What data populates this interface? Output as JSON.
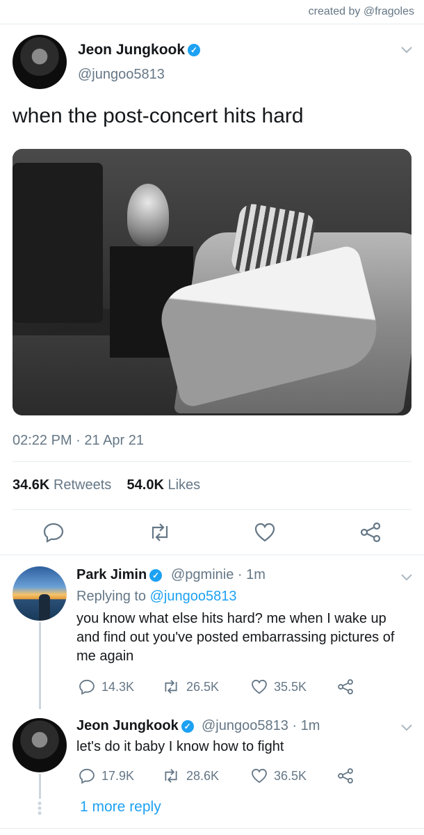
{
  "credit": "created by @fragoles",
  "main_tweet": {
    "name": "Jeon Jungkook",
    "handle": "@jungoo5813",
    "text": "when the post-concert hits hard",
    "timestamp": "02:22 PM · 21 Apr 21",
    "retweets_count": "34.6K",
    "retweets_label": "Retweets",
    "likes_count": "54.0K",
    "likes_label": "Likes"
  },
  "replies": [
    {
      "name": "Park Jimin",
      "handle": "@pgminie",
      "time": "· 1m",
      "replying_prefix": "Replying to",
      "replying_to": "@jungoo5813",
      "text": "you know what else hits hard? me when I wake up and find out you've posted embarrassing pictures of me again",
      "replies": "14.3K",
      "retweets": "26.5K",
      "likes": "35.5K"
    },
    {
      "name": "Jeon Jungkook",
      "handle": "@jungoo5813",
      "time": "· 1m",
      "text": "let's do it baby I know how to fight",
      "replies": "17.9K",
      "retweets": "28.6K",
      "likes": "36.5K"
    }
  ],
  "more_replies": "1 more reply",
  "colors": {
    "accent": "#1da1f2",
    "muted": "#657786",
    "text": "#14171a"
  }
}
